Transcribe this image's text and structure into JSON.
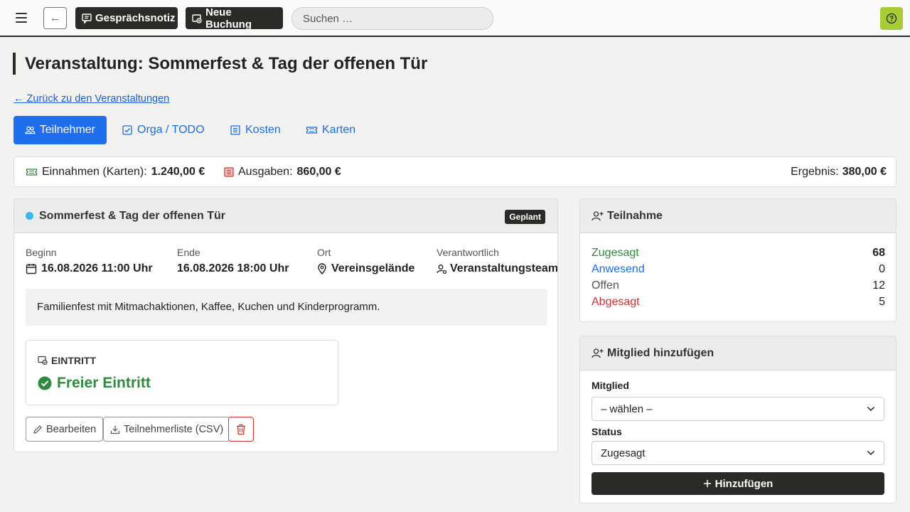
{
  "topbar": {
    "note_label": "Gesprächsnotiz",
    "booking_label": "Neue Buchung",
    "search_placeholder": "Suchen …",
    "accent": "#a6cc37"
  },
  "page": {
    "title": "Veranstaltung: Sommerfest & Tag der offenen Tür",
    "back_link": "← Zurück zu den Veranstaltungen"
  },
  "tabs": [
    {
      "label": "Teilnehmer",
      "icon": "users-icon",
      "active": true
    },
    {
      "label": "Orga / TODO",
      "icon": "checkbox-icon",
      "active": false
    },
    {
      "label": "Kosten",
      "icon": "list-icon",
      "active": false
    },
    {
      "label": "Karten",
      "icon": "ticket-icon",
      "active": false
    }
  ],
  "summary": {
    "income_label": "Einnahmen (Karten):",
    "income_value": "1.240,00 €",
    "expense_label": "Ausgaben:",
    "expense_value": "860,00 €",
    "result_label": "Ergebnis:",
    "result_value": "380,00 €"
  },
  "event": {
    "name": "Sommerfest & Tag der offenen Tür",
    "status": "Geplant",
    "start_label": "Beginn",
    "start_value": "16.08.2026 11:00 Uhr",
    "end_label": "Ende",
    "end_value": "16.08.2026 18:00 Uhr",
    "location_label": "Ort",
    "location_value": "Vereinsgelände",
    "responsible_label": "Verantwortlich",
    "responsible_value": "Veranstaltungsteam",
    "description": "Familienfest mit Mitmachaktionen, Kaffee, Kuchen und Kinderprogramm.",
    "entry_label": "EINTRITT",
    "entry_value": "Freier Eintritt",
    "edit_label": "Bearbeiten",
    "csv_label": "Teilnehmerliste (CSV)"
  },
  "participation": {
    "title": "Teilnahme",
    "rows": [
      {
        "label": "Zugesagt",
        "value": "68",
        "color": "#2e8b3e"
      },
      {
        "label": "Anwesend",
        "value": "0",
        "color": "#1a6fe0"
      },
      {
        "label": "Offen",
        "value": "12",
        "color": "#555555"
      },
      {
        "label": "Abgesagt",
        "value": "5",
        "color": "#d32f2f"
      }
    ]
  },
  "add_member": {
    "title": "Mitglied hinzufügen",
    "member_label": "Mitglied",
    "member_value": "– wählen –",
    "status_label": "Status",
    "status_value": "Zugesagt",
    "button_label": "Hinzufügen"
  }
}
